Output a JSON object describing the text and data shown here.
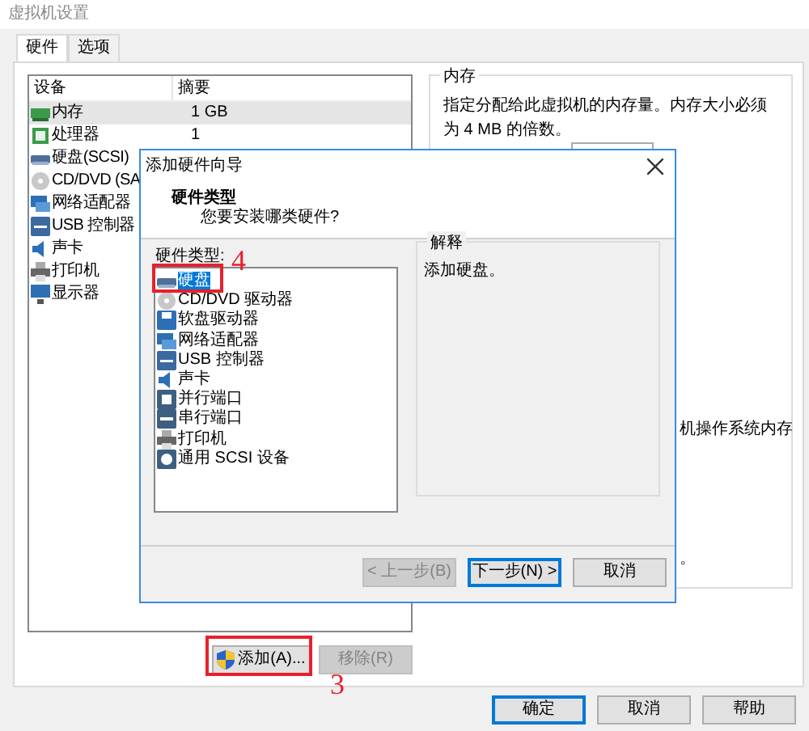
{
  "window": {
    "title": "虚拟机设置"
  },
  "tabs": [
    {
      "label": "硬件",
      "selected": true
    },
    {
      "label": "选项",
      "selected": false
    }
  ],
  "device_list": {
    "columns": [
      "设备",
      "摘要"
    ],
    "rows": [
      {
        "name": "内存",
        "summary": "1 GB",
        "kind": "memory",
        "selected": true
      },
      {
        "name": "处理器",
        "summary": "1",
        "kind": "processor",
        "selected": false
      },
      {
        "name": "硬盘(SCSI)",
        "kind": "disk",
        "selected": false
      },
      {
        "name": "CD/DVD (SA",
        "kind": "disc",
        "selected": false
      },
      {
        "name": "网络适配器",
        "kind": "network",
        "selected": false
      },
      {
        "name": "USB 控制器",
        "kind": "usb",
        "selected": false
      },
      {
        "name": "声卡",
        "kind": "sound",
        "selected": false
      },
      {
        "name": "打印机",
        "kind": "printer",
        "selected": false
      },
      {
        "name": "显示器",
        "kind": "display",
        "selected": false
      }
    ]
  },
  "device_buttons": [
    {
      "label": "添加(A)...",
      "disabled": false,
      "elevated": true
    },
    {
      "label": "移除(R)",
      "disabled": true,
      "elevated": false
    }
  ],
  "memory_panel": {
    "title": "内存",
    "description": "指定分配给此虚拟机的内存量。内存大小必须为 4 MB 的倍数。",
    "fragments": [
      "机操作系统内存",
      "。"
    ]
  },
  "footer_buttons": [
    {
      "label": "确定",
      "default": true
    },
    {
      "label": "取消",
      "default": false
    },
    {
      "label": "帮助",
      "default": false
    }
  ],
  "wizard": {
    "title": "添加硬件向导",
    "heading": "硬件类型",
    "subheading": "您要安装哪类硬件?",
    "list_label": "硬件类型:",
    "items": [
      {
        "label": "硬盘",
        "kind": "disk",
        "selected": true
      },
      {
        "label": "CD/DVD 驱动器",
        "kind": "disc",
        "selected": false
      },
      {
        "label": "软盘驱动器",
        "kind": "floppy",
        "selected": false
      },
      {
        "label": "网络适配器",
        "kind": "network",
        "selected": false
      },
      {
        "label": "USB 控制器",
        "kind": "usb",
        "selected": false
      },
      {
        "label": "声卡",
        "kind": "sound",
        "selected": false
      },
      {
        "label": "并行端口",
        "kind": "parallel",
        "selected": false
      },
      {
        "label": "串行端口",
        "kind": "serial",
        "selected": false
      },
      {
        "label": "打印机",
        "kind": "printer",
        "selected": false
      },
      {
        "label": "通用 SCSI 设备",
        "kind": "scsi",
        "selected": false
      }
    ],
    "explanation_title": "解释",
    "explanation": "添加硬盘。",
    "buttons": [
      {
        "label": "< 上一步(B)",
        "disabled": true,
        "default": false
      },
      {
        "label": "下一步(N) >",
        "disabled": false,
        "default": true
      },
      {
        "label": "取消",
        "disabled": false,
        "default": false
      }
    ]
  },
  "annotations": [
    {
      "kind": "wizard-item",
      "label": "4"
    },
    {
      "kind": "add-button",
      "label": "3"
    }
  ]
}
